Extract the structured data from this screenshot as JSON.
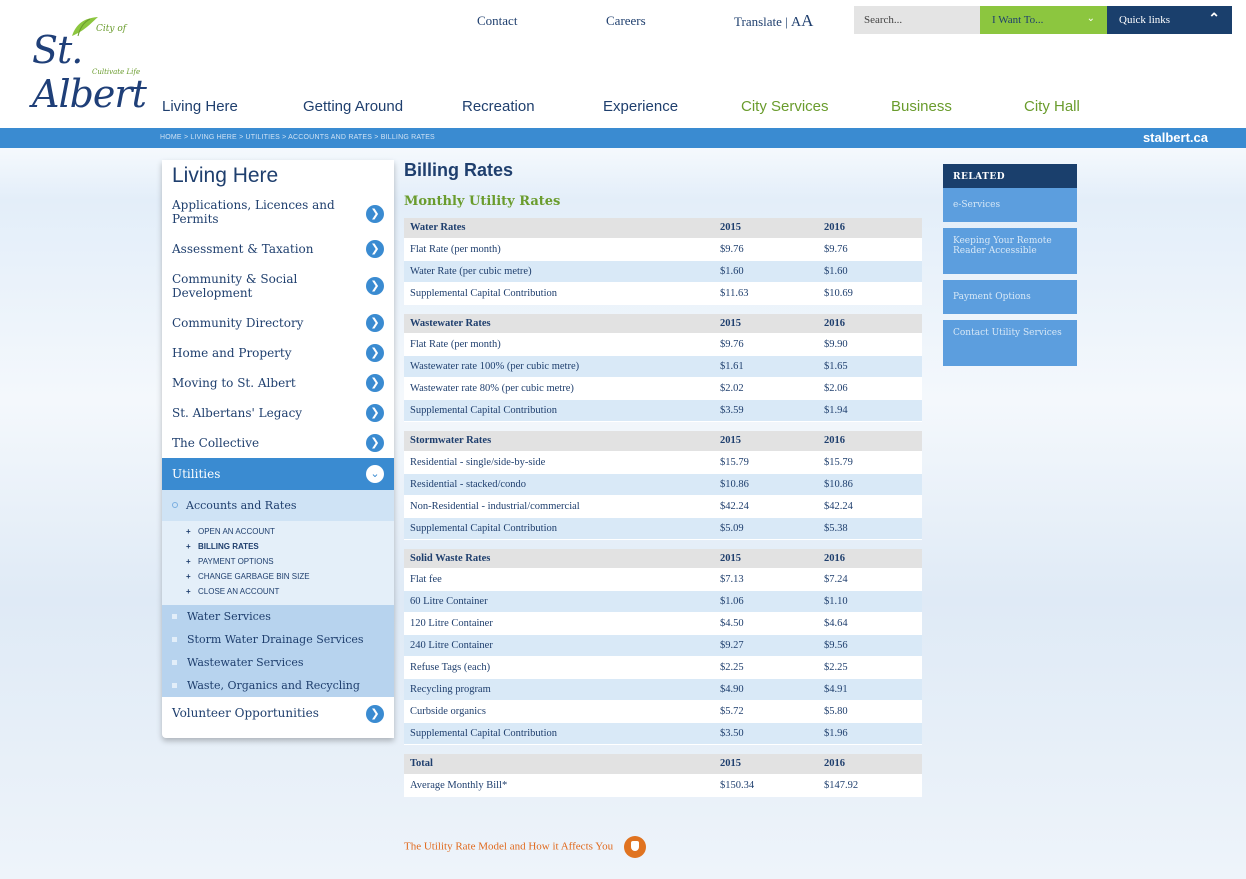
{
  "header": {
    "logo": {
      "city_of": "City of",
      "brand": "St. Albert",
      "tagline": "Cultivate Life"
    },
    "top_links": [
      "Contact",
      "Careers"
    ],
    "translate_label": "Translate",
    "font_size_label": "A",
    "font_size_large_label": "A",
    "search_placeholder": "Search...",
    "i_want_to": "I Want To...",
    "quick_links": "Quick links"
  },
  "main_nav": [
    "Living Here",
    "Getting Around",
    "Recreation",
    "Experience",
    "City Services",
    "Business",
    "City Hall"
  ],
  "breadcrumb": "HOME > LIVING HERE > UTILITIES > ACCOUNTS AND RATES > BILLING RATES",
  "domain_mark": "stalbert.ca",
  "sidebar": {
    "title": "Living Here",
    "items": [
      "Applications, Licences and Permits",
      "Assessment & Taxation",
      "Community & Social Development",
      "Community Directory",
      "Home and Property",
      "Moving to St. Albert",
      "St. Albertans' Legacy",
      "The Collective"
    ],
    "utilities": "Utilities",
    "accounts": "Accounts and Rates",
    "account_links": [
      "OPEN AN ACCOUNT",
      "BILLING RATES",
      "PAYMENT OPTIONS",
      "CHANGE GARBAGE BIN SIZE",
      "CLOSE AN ACCOUNT"
    ],
    "utility_sections": [
      "Water Services",
      "Storm Water Drainage Services",
      "Wastewater Services",
      "Waste, Organics and Recycling"
    ],
    "volunteer": "Volunteer Opportunities"
  },
  "content": {
    "title": "Billing Rates",
    "subtitle": "Monthly Utility Rates",
    "tables": [
      {
        "header": [
          "Water Rates",
          "2015",
          "2016"
        ],
        "rows": [
          [
            "Flat Rate (per month)",
            "$9.76",
            "$9.76"
          ],
          [
            "Water Rate (per cubic metre)",
            "$1.60",
            "$1.60"
          ],
          [
            "Supplemental Capital Contribution",
            "$11.63",
            "$10.69"
          ]
        ]
      },
      {
        "header": [
          "Wastewater Rates",
          "2015",
          "2016"
        ],
        "rows": [
          [
            "Flat Rate (per month)",
            "$9.76",
            "$9.90"
          ],
          [
            "Wastewater rate 100% (per cubic metre)",
            "$1.61",
            "$1.65"
          ],
          [
            "Wastewater rate 80% (per cubic metre)",
            "$2.02",
            "$2.06"
          ],
          [
            "Supplemental Capital Contribution",
            "$3.59",
            "$1.94"
          ]
        ]
      },
      {
        "header": [
          "Stormwater Rates",
          "2015",
          "2016"
        ],
        "rows": [
          [
            "Residential - single/side-by-side",
            "$15.79",
            "$15.79"
          ],
          [
            "Residential - stacked/condo",
            "$10.86",
            "$10.86"
          ],
          [
            "Non-Residential - industrial/commercial",
            "$42.24",
            "$42.24"
          ],
          [
            "Supplemental Capital Contribution",
            "$5.09",
            "$5.38"
          ]
        ]
      },
      {
        "header": [
          "Solid Waste Rates",
          "2015",
          "2016"
        ],
        "rows": [
          [
            "Flat fee",
            "$7.13",
            "$7.24"
          ],
          [
            "60 Litre Container",
            "$1.06",
            "$1.10"
          ],
          [
            "120 Litre Container",
            "$4.50",
            "$4.64"
          ],
          [
            "240 Litre Container",
            "$9.27",
            "$9.56"
          ],
          [
            "Refuse Tags (each)",
            "$2.25",
            "$2.25"
          ],
          [
            "Recycling program",
            "$4.90",
            "$4.91"
          ],
          [
            "Curbside organics",
            "$5.72",
            "$5.80"
          ],
          [
            "Supplemental Capital Contribution",
            "$3.50",
            "$1.96"
          ]
        ]
      },
      {
        "header": [
          "Total",
          "2015",
          "2016"
        ],
        "rows": [
          [
            "Average Monthly Bill*",
            "$150.34",
            "$147.92"
          ]
        ]
      }
    ],
    "bottom_link": "The Utility Rate Model and How it Affects You"
  },
  "related": {
    "title": "RELATED",
    "items": [
      "e-Services",
      "Keeping Your Remote Reader Accessible",
      "Payment Options",
      "Contact Utility Services"
    ]
  }
}
